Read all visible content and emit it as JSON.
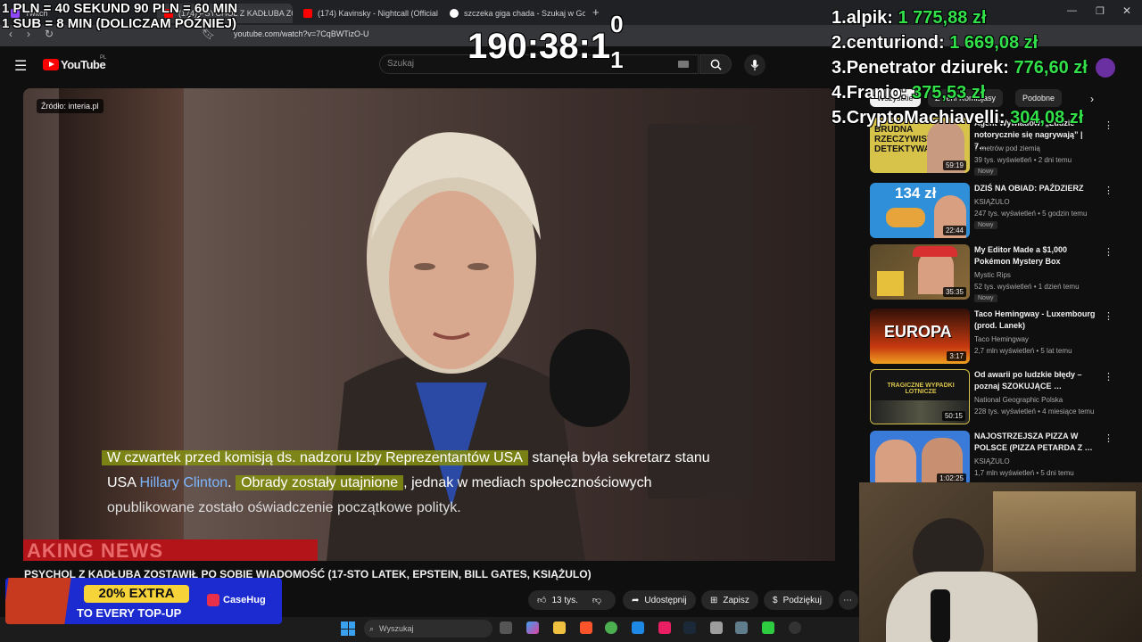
{
  "browser": {
    "tabs": [
      {
        "label": "Twitch",
        "color": "#9146ff"
      },
      {
        "label": "(174) PSYCHOL Z KADŁUBA ZOS…",
        "color": "#ff0000"
      },
      {
        "label": "(174) Kavinsky - Nightcall (Official Au…",
        "color": "#ff0000"
      },
      {
        "label": "szczeka giga chada - Szukaj w Google",
        "color": "#4285f4"
      }
    ],
    "url": "youtube.com/watch?v=7CqBWTizO-U"
  },
  "youtube": {
    "logo": "YouTube",
    "region": "PL",
    "search_placeholder": "Szukaj"
  },
  "video": {
    "source_badge": "Źródło: interia.pl",
    "subtitle": {
      "hl1": "W czwartek przed komisją ds. nadzoru Izby Reprezentantów USA",
      "p1": " stanęła była sekretarz stanu",
      "p2": "USA ",
      "name": "Hillary Clinton",
      "p3": ". ",
      "hl2": "Obrady zostały utajnione",
      "p4": ", jednak w mediach społecznościowych",
      "line3": "opublikowane zostało oświadczenie początkowe polityk."
    },
    "banner": "AKING NEWS",
    "title": "PSYCHOL Z KADŁUBA ZOSTAWIŁ PO SOBIE WIADOMOŚĆ (17-STO LATEK, EPSTEIN, BILL GATES, KSIĄŻULO)",
    "likes": "13 tys.",
    "share": "Udostępnij",
    "save": "Zapisz",
    "thanks": "Podziękuj"
  },
  "sidebar": {
    "chips": [
      "Wszystkie",
      "Z serii Komisjasy",
      "Podobne"
    ],
    "items": [
      {
        "thumb": "BRUDNA RZECZYWISTOŚĆ DETEKTYWA",
        "duration": "59:19",
        "title": "Agent Wywiadów: „Ludzie notorycznie się nagrywają” | 7…",
        "channel": "7 metrów pod ziemią",
        "meta": "39 tys. wyświetleń • 2 dni temu",
        "badge": "Nowy",
        "color": "#d8c34a"
      },
      {
        "thumb": "134 zł",
        "duration": "22:44",
        "title": "DZIŚ NA OBIAD: PAŹDZIERZ",
        "channel": "KSIĄŻULO",
        "meta": "247 tys. wyświetleń • 5 godzin temu",
        "badge": "Nowy",
        "color": "#2f8fd8"
      },
      {
        "thumb": "",
        "duration": "35:35",
        "title": "My Editor Made a $1,000 Pokémon Mystery Box",
        "channel": "Mystic Rips",
        "meta": "52 tys. wyświetleń • 1 dzień temu",
        "badge": "Nowy",
        "color": "#6a5a2a"
      },
      {
        "thumb": "EUROPA",
        "duration": "3:17",
        "title": "Taco Hemingway - Luxembourg (prod. Lanek)",
        "channel": "Taco Hemingway",
        "meta": "2,7 mln wyświetleń • 5 lat temu",
        "badge": "",
        "color": "#c83a10"
      },
      {
        "thumb": "TRAGICZNE WYPADKI LOTNICZE",
        "duration": "50:15",
        "title": "Od awarii po ludzkie błędy – poznaj SZOKUJĄCE …",
        "channel": "National Geographic Polska",
        "meta": "228 tys. wyświetleń • 4 miesiące temu",
        "badge": "",
        "color": "#1a1a1a"
      },
      {
        "thumb": "",
        "duration": "1:02:25",
        "title": "NAJOSTRZEJSZA PIZZA W POLSCE (PIZZA PETARDA Z …",
        "channel": "KSIĄŻULO",
        "meta": "1,7 mln wyświetleń • 5 dni temu",
        "badge": "",
        "color": "#3a7ad8"
      }
    ]
  },
  "overlay": {
    "rule1": "1 PLN = 40 SEKUND 90 PLN = 60 MIN",
    "rule2": "1 SUB = 8 MIN (DOLICZAM PÓŹNIEJ)",
    "timer": "190:38:1",
    "timer_roll": "0",
    "timer_roll2": "1",
    "leaderboard": [
      {
        "rank": "1.",
        "name": "alpik:",
        "amount": "1 775,88 zł"
      },
      {
        "rank": "2.",
        "name": "centuriond:",
        "amount": "1 669,08 zł"
      },
      {
        "rank": "3.",
        "name": "Penetrator dziurek:",
        "amount": "776,60 zł"
      },
      {
        "rank": "4.",
        "name": "Franio:",
        "amount": "375,53 zł"
      },
      {
        "rank": "5.",
        "name": "CryptoMachiavelli:",
        "amount": "304,08 zł"
      }
    ],
    "promo_line1": "20% EXTRA",
    "promo_line2": "TO EVERY TOP-UP",
    "promo_brand": "CaseHug"
  },
  "taskbar": {
    "search_placeholder": "Wyszukaj"
  }
}
